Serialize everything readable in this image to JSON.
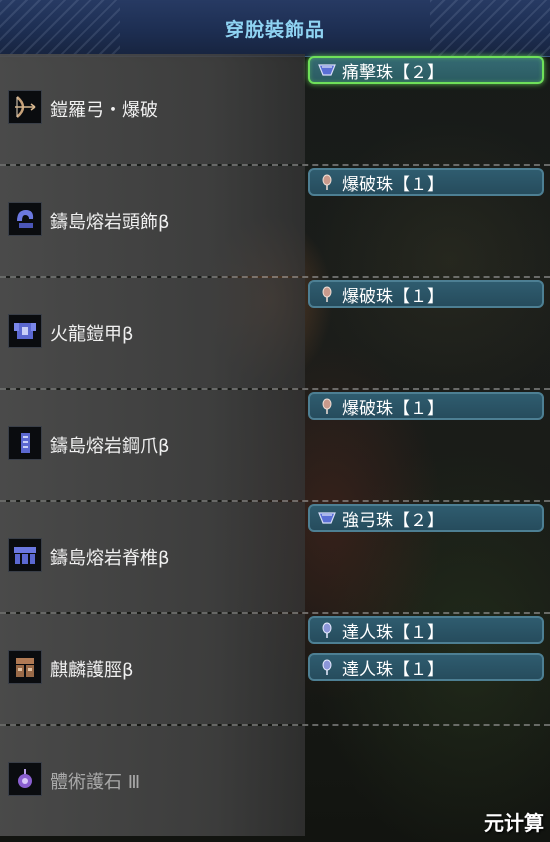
{
  "header": {
    "title": "穿脫裝飾品"
  },
  "equipment": [
    {
      "name": "鎧羅弓・爆破",
      "icon": "bow-icon",
      "decorations": [
        {
          "label": "痛擊珠【２】",
          "icon": "jewel-2-icon",
          "selected": true
        }
      ]
    },
    {
      "name": "鑄島熔岩頭飾β",
      "icon": "helmet-icon",
      "decorations": [
        {
          "label": "爆破珠【１】",
          "icon": "jewel-1-icon"
        }
      ]
    },
    {
      "name": "火龍鎧甲β",
      "icon": "chest-armor-icon",
      "decorations": [
        {
          "label": "爆破珠【１】",
          "icon": "jewel-1-icon"
        }
      ]
    },
    {
      "name": "鑄島熔岩鋼爪β",
      "icon": "arm-armor-icon",
      "decorations": [
        {
          "label": "爆破珠【１】",
          "icon": "jewel-1-icon"
        }
      ]
    },
    {
      "name": "鑄島熔岩脊椎β",
      "icon": "waist-armor-icon",
      "decorations": [
        {
          "label": "強弓珠【２】",
          "icon": "jewel-2-icon"
        }
      ]
    },
    {
      "name": "麒麟護脛β",
      "icon": "leg-armor-icon",
      "decorations": [
        {
          "label": "達人珠【１】",
          "icon": "jewel-1-icon"
        },
        {
          "label": "達人珠【１】",
          "icon": "jewel-1-icon"
        }
      ]
    },
    {
      "name": "體術護石 Ⅲ",
      "icon": "charm-icon",
      "decorations": []
    }
  ],
  "watermark": "元计算",
  "colors": {
    "selected_border": "#6fe05a",
    "slot_fill": "#2f5c6f",
    "title": "#8fd3f2"
  }
}
